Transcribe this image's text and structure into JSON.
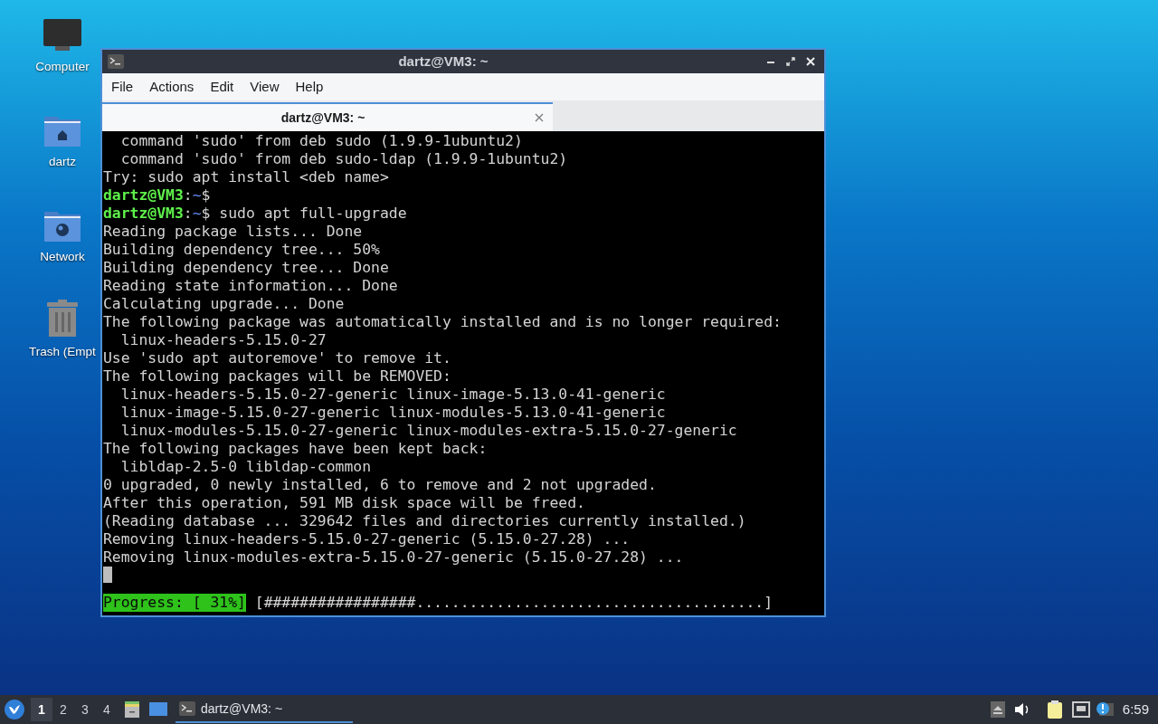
{
  "desktop_icons": [
    {
      "kind": "computer",
      "label": "Computer"
    },
    {
      "kind": "home",
      "label": "dartz"
    },
    {
      "kind": "network",
      "label": "Network"
    },
    {
      "kind": "trash",
      "label": "Trash (Empt"
    }
  ],
  "window": {
    "title": "dartz@VM3: ~",
    "menu": [
      "File",
      "Actions",
      "Edit",
      "View",
      "Help"
    ],
    "tabs": [
      {
        "label": "dartz@VM3: ~",
        "selected": true
      }
    ],
    "terminal": {
      "lines": [
        {
          "kind": "output",
          "text": "  command 'sudo' from deb sudo (1.9.9-1ubuntu2)"
        },
        {
          "kind": "output",
          "text": "  command 'sudo' from deb sudo-ldap (1.9.9-1ubuntu2)"
        },
        {
          "kind": "output",
          "text": "Try: sudo apt install <deb name>"
        },
        {
          "kind": "prompt",
          "user": "dartz@VM3",
          "sep": ":",
          "path": "~",
          "suffix": "$"
        },
        {
          "kind": "prompt",
          "user": "dartz@VM3",
          "sep": ":",
          "path": "~",
          "suffix": "$",
          "command": " sudo apt full-upgrade"
        },
        {
          "kind": "output",
          "text": "Reading package lists... Done"
        },
        {
          "kind": "output",
          "text": "Building dependency tree... 50%"
        },
        {
          "kind": "output",
          "text": "Building dependency tree... Done"
        },
        {
          "kind": "output",
          "text": "Reading state information... Done"
        },
        {
          "kind": "output",
          "text": "Calculating upgrade... Done"
        },
        {
          "kind": "output",
          "text": "The following package was automatically installed and is no longer required:"
        },
        {
          "kind": "output",
          "text": "  linux-headers-5.15.0-27"
        },
        {
          "kind": "output",
          "text": "Use 'sudo apt autoremove' to remove it."
        },
        {
          "kind": "output",
          "text": "The following packages will be REMOVED:"
        },
        {
          "kind": "output",
          "text": "  linux-headers-5.15.0-27-generic linux-image-5.13.0-41-generic"
        },
        {
          "kind": "output",
          "text": "  linux-image-5.15.0-27-generic linux-modules-5.13.0-41-generic"
        },
        {
          "kind": "output",
          "text": "  linux-modules-5.15.0-27-generic linux-modules-extra-5.15.0-27-generic"
        },
        {
          "kind": "output",
          "text": "The following packages have been kept back:"
        },
        {
          "kind": "output",
          "text": "  libldap-2.5-0 libldap-common"
        },
        {
          "kind": "output",
          "text": "0 upgraded, 0 newly installed, 6 to remove and 2 not upgraded."
        },
        {
          "kind": "output",
          "text": "After this operation, 591 MB disk space will be freed."
        },
        {
          "kind": "output",
          "text": "(Reading database ... 329642 files and directories currently installed.)"
        },
        {
          "kind": "output",
          "text": "Removing linux-headers-5.15.0-27-generic (5.15.0-27.28) ..."
        },
        {
          "kind": "output",
          "text": "Removing linux-modules-extra-5.15.0-27-generic (5.15.0-27.28) ..."
        },
        {
          "kind": "cursor"
        },
        {
          "kind": "blank"
        },
        {
          "kind": "progress",
          "label": "Progress: [ 31%]",
          "bar": " [#################.......................................]"
        }
      ]
    }
  },
  "taskbar": {
    "workspaces": [
      {
        "label": "1",
        "selected": true
      },
      {
        "label": "2",
        "selected": false
      },
      {
        "label": "3",
        "selected": false
      },
      {
        "label": "4",
        "selected": false
      }
    ],
    "tasks": [
      {
        "label": "dartz@VM3: ~",
        "selected": true
      }
    ],
    "clock": "6:59"
  }
}
